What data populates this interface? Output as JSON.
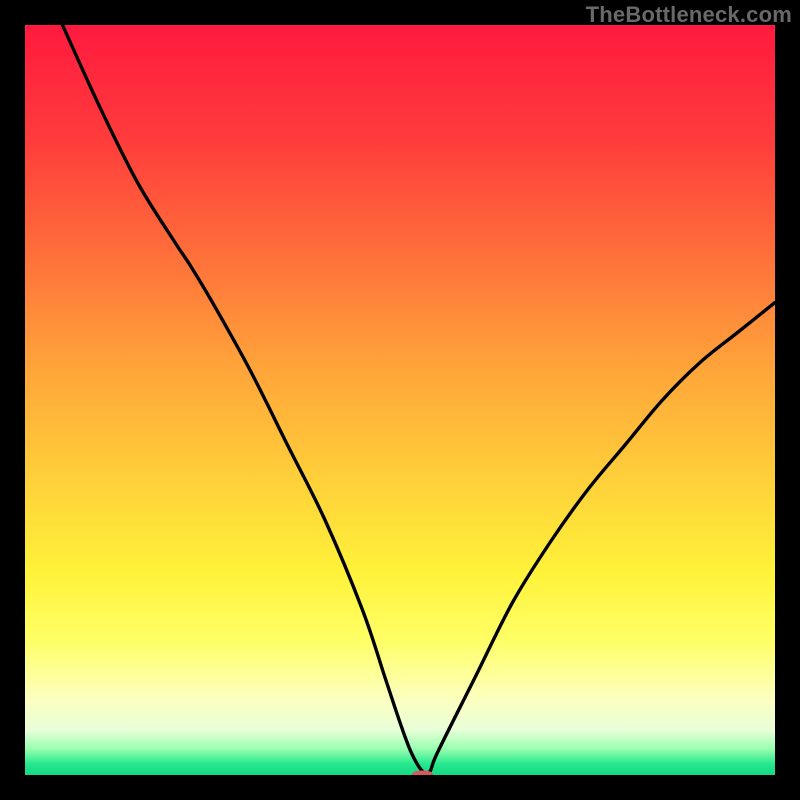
{
  "watermark": "TheBottleneck.com",
  "chart_data": {
    "type": "line",
    "title": "",
    "xlabel": "",
    "ylabel": "",
    "xlim": [
      0,
      100
    ],
    "ylim": [
      0,
      100
    ],
    "grid": false,
    "legend": false,
    "background_gradient": {
      "stops": [
        {
          "pos": 0.0,
          "color": "#ff1a3f"
        },
        {
          "pos": 0.15,
          "color": "#ff3b3c"
        },
        {
          "pos": 0.3,
          "color": "#ff6d3a"
        },
        {
          "pos": 0.45,
          "color": "#ffa23a"
        },
        {
          "pos": 0.6,
          "color": "#ffce3a"
        },
        {
          "pos": 0.73,
          "color": "#fff23a"
        },
        {
          "pos": 0.82,
          "color": "#ffff66"
        },
        {
          "pos": 0.9,
          "color": "#fcffc0"
        },
        {
          "pos": 0.94,
          "color": "#e8ffd8"
        },
        {
          "pos": 0.965,
          "color": "#9affb0"
        },
        {
          "pos": 0.985,
          "color": "#27e88f"
        },
        {
          "pos": 1.0,
          "color": "#14d884"
        }
      ]
    },
    "series": [
      {
        "name": "bottleneck-curve",
        "color": "#000000",
        "x": [
          5,
          10,
          15,
          20,
          22,
          25,
          30,
          35,
          40,
          45,
          48,
          50,
          51.5,
          53,
          54,
          55,
          60,
          65,
          70,
          75,
          80,
          85,
          90,
          95,
          100
        ],
        "y": [
          100,
          89,
          79,
          71,
          68,
          63,
          54,
          44,
          34,
          22,
          13,
          7,
          3,
          0.5,
          0.5,
          3,
          13,
          23,
          31,
          38,
          44,
          50,
          55,
          59,
          63
        ]
      }
    ],
    "marker": {
      "name": "optimum-marker",
      "x": 53,
      "y": 0,
      "width": 2.8,
      "height": 1.2,
      "rx": 1.0,
      "color": "#d25a5a"
    }
  }
}
